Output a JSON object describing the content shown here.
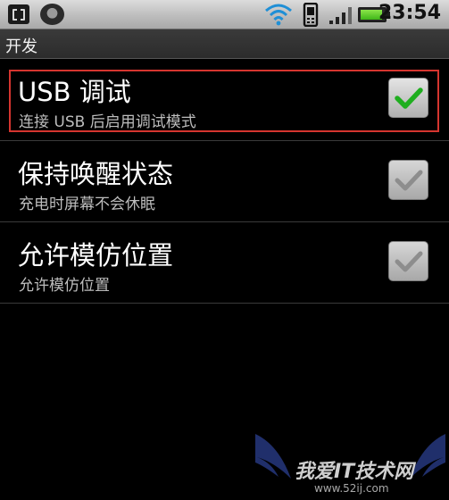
{
  "status_bar": {
    "time": "23:54",
    "icons": [
      "app-icon",
      "app-round-icon",
      "wifi-icon",
      "phone-icon",
      "signal-icon",
      "battery-icon"
    ]
  },
  "header": {
    "title": "开发"
  },
  "settings": {
    "items": [
      {
        "title": "USB 调试",
        "summary": "连接 USB 后启用调试模式",
        "checked": true
      },
      {
        "title": "保持唤醒状态",
        "summary": "充电时屏幕不会休眠",
        "checked": false
      },
      {
        "title": "允许模仿位置",
        "summary": "允许模仿位置",
        "checked": false
      }
    ]
  },
  "watermark": {
    "text": "我爱IT技术网",
    "url": "www.52ij.com"
  },
  "colors": {
    "check_on": "#1fae1f",
    "check_off": "#8d8d8d",
    "selection_border": "#d5352f"
  }
}
